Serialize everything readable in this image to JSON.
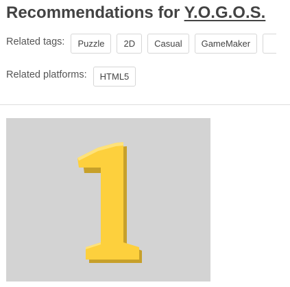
{
  "header": {
    "title_prefix": "Recommendations for ",
    "game_name": "Y.O.G.O.S."
  },
  "tags": {
    "label": "Related tags:",
    "items": [
      "Puzzle",
      "2D",
      "Casual",
      "GameMaker"
    ]
  },
  "platforms": {
    "label": "Related platforms:",
    "items": [
      "HTML5"
    ]
  },
  "colors": {
    "text": "#434343",
    "tag_border": "#d6d6d6",
    "thumb_bg": "#d3d3d3",
    "digit_fill": "#fdd03d",
    "digit_shadow": "#c7a02a"
  },
  "thumbnail": {
    "icon": "number-one-icon"
  }
}
